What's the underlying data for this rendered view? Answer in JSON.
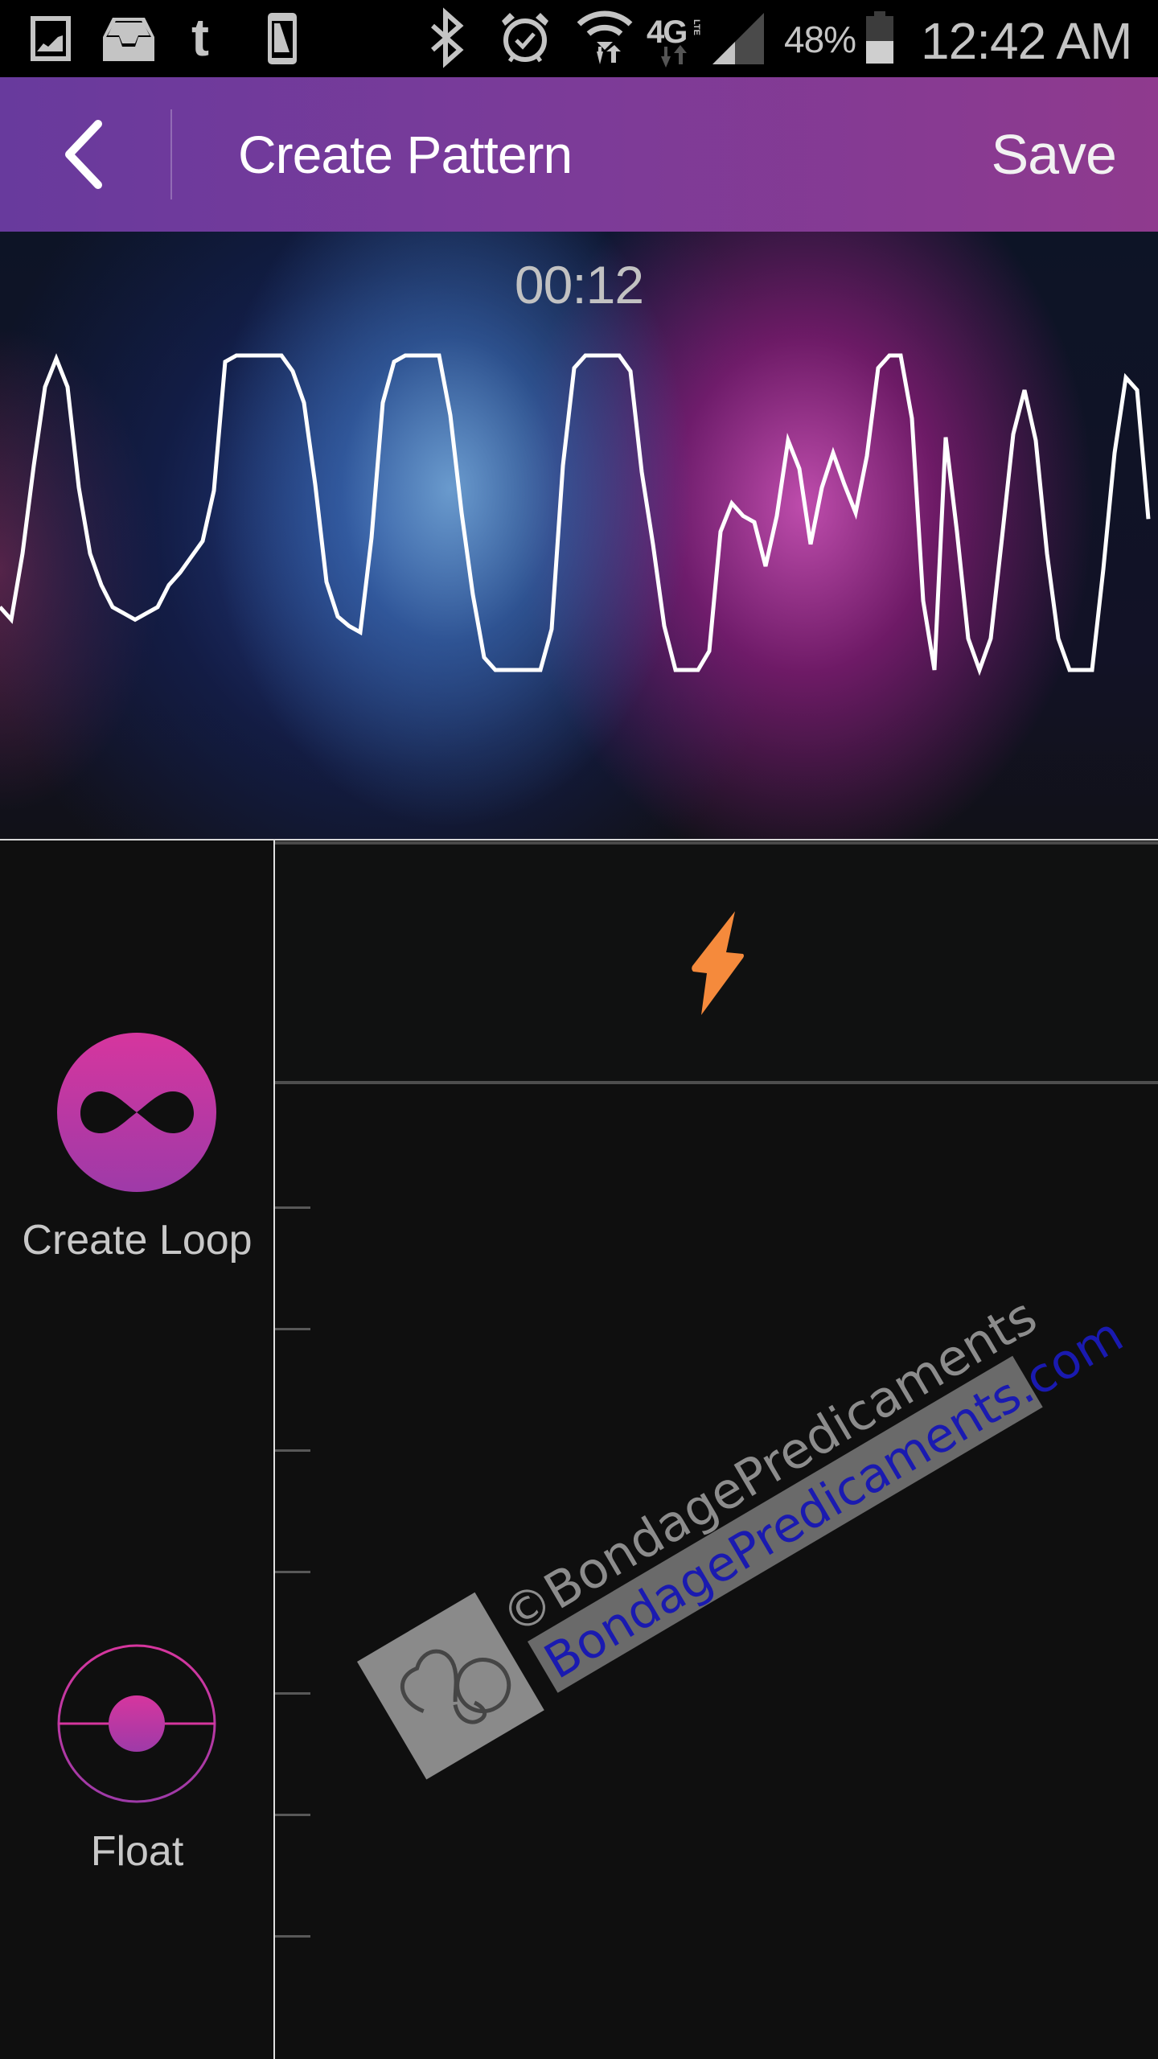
{
  "status_bar": {
    "left_icons": [
      "gallery-icon",
      "inbox-icon",
      "tumblr-icon",
      "phone-rotate-icon"
    ],
    "right_icons": [
      "bluetooth-icon",
      "alarm-icon",
      "wifi-icon",
      "4g-lte-icon",
      "signal-icon",
      "battery-icon"
    ],
    "network_label": "4G",
    "network_sub": "LTE",
    "battery_percent": "48%",
    "battery_level": 0.48,
    "time": "12:42 AM"
  },
  "header": {
    "back_icon": "chevron-left-icon",
    "title": "Create Pattern",
    "save_label": "Save",
    "gradient_start": "#683a9d",
    "gradient_end": "#8f3a8e"
  },
  "pattern": {
    "elapsed": "00:12",
    "waveform_levels": [
      0.2,
      0.16,
      0.37,
      0.65,
      0.9,
      0.99,
      0.9,
      0.58,
      0.37,
      0.27,
      0.2,
      0.18,
      0.16,
      0.18,
      0.2,
      0.27,
      0.31,
      0.36,
      0.41,
      0.57,
      0.98,
      1.0,
      1.0,
      1.0,
      1.0,
      1.0,
      0.95,
      0.85,
      0.59,
      0.28,
      0.17,
      0.14,
      0.12,
      0.42,
      0.85,
      0.98,
      1.0,
      1.0,
      1.0,
      1.0,
      0.81,
      0.5,
      0.24,
      0.04,
      0.0,
      0.0,
      0.0,
      0.0,
      0.0,
      0.13,
      0.65,
      0.96,
      1.0,
      1.0,
      1.0,
      1.0,
      0.95,
      0.63,
      0.4,
      0.14,
      0.0,
      0.0,
      0.0,
      0.06,
      0.44,
      0.53,
      0.49,
      0.47,
      0.33,
      0.49,
      0.73,
      0.64,
      0.4,
      0.58,
      0.69,
      0.59,
      0.5,
      0.68,
      0.96,
      1.0,
      1.0,
      0.8,
      0.22,
      0.0,
      0.74,
      0.44,
      0.1,
      0.0,
      0.1,
      0.42,
      0.75,
      0.89,
      0.73,
      0.37,
      0.1,
      0.0,
      0.0,
      0.0,
      0.32,
      0.69,
      0.93,
      0.89,
      0.48
    ],
    "line_color": "#ffffff"
  },
  "boost": {
    "icon": "lightning-bolt-icon",
    "color": "#f58a3c"
  },
  "modes": [
    {
      "id": "create-loop",
      "label": "Create Loop",
      "icon": "infinity-icon"
    },
    {
      "id": "float",
      "label": "Float",
      "icon": "float-target-icon"
    }
  ],
  "accent": {
    "pink": "#d6369e",
    "purple": "#9e3aa8"
  },
  "intensity_ticks": 7,
  "watermark": {
    "line1": "©BondagePredicaments",
    "line2": "BondagePredicaments.com",
    "logo_icon": "handcuffs-icon"
  }
}
